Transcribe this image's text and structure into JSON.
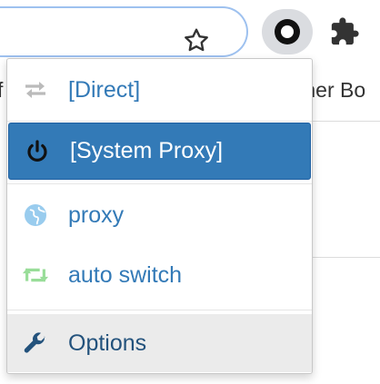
{
  "toolbar": {
    "bookmark_icon": "star-outline-icon",
    "active_extension_icon": "switchyomega-ring-icon",
    "extensions_icon": "puzzle-icon"
  },
  "background": {
    "left_text": "f",
    "right_text": "ther Bo"
  },
  "menu": {
    "items": [
      {
        "label": "[Direct]",
        "icon": "arrows-swap-icon",
        "icon_color": "#bbbbbb"
      },
      {
        "label": "[System Proxy]",
        "icon": "power-icon",
        "icon_color": "#111111",
        "active": true
      },
      {
        "label": "proxy",
        "icon": "globe-icon",
        "icon_color": "#99ccee"
      },
      {
        "label": "auto switch",
        "icon": "retweet-icon",
        "icon_color": "#99dd99"
      },
      {
        "label": "Options",
        "icon": "wrench-icon",
        "icon_color": "#23527c"
      }
    ]
  },
  "colors": {
    "link": "#337ab7",
    "active_bg": "#337ab7",
    "options_bg": "#ebebeb"
  }
}
